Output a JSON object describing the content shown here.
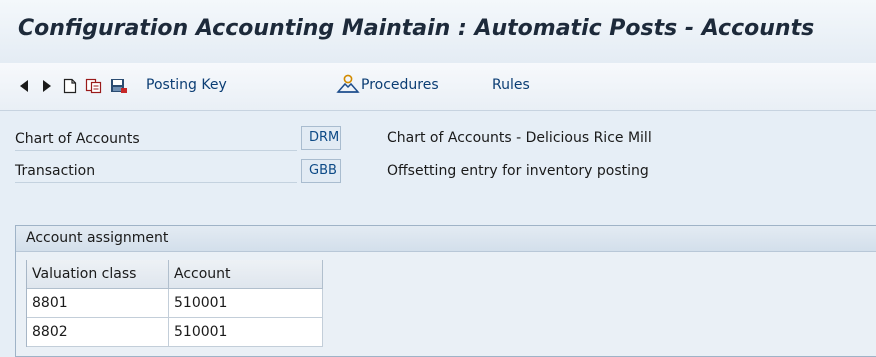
{
  "window": {
    "title": "Configuration Accounting Maintain : Automatic Posts - Accounts"
  },
  "toolbar": {
    "icons": [
      "back-arrow-icon",
      "forward-arrow-icon",
      "new-document-icon",
      "copy-icon",
      "save-icon"
    ],
    "posting_key_label": "Posting Key",
    "procedures_label": "Procedures",
    "rules_label": "Rules"
  },
  "header_fields": {
    "chart_of_accounts": {
      "label": "Chart of Accounts",
      "value": "DRM",
      "description": "Chart of Accounts - Delicious Rice Mill"
    },
    "transaction": {
      "label": "Transaction",
      "value": "GBB",
      "description": "Offsetting entry for inventory posting"
    }
  },
  "account_assignment": {
    "title": "Account assignment",
    "columns": [
      "Valuation class",
      "Account"
    ],
    "rows": [
      {
        "valuation_class": "8801",
        "account": "510001"
      },
      {
        "valuation_class": "8802",
        "account": "510001"
      }
    ]
  },
  "colors": {
    "background": "#e6eef6",
    "link_text": "#0b3d74",
    "field_value_text": "#0d4a86",
    "field_background": "#e2ebf4"
  }
}
